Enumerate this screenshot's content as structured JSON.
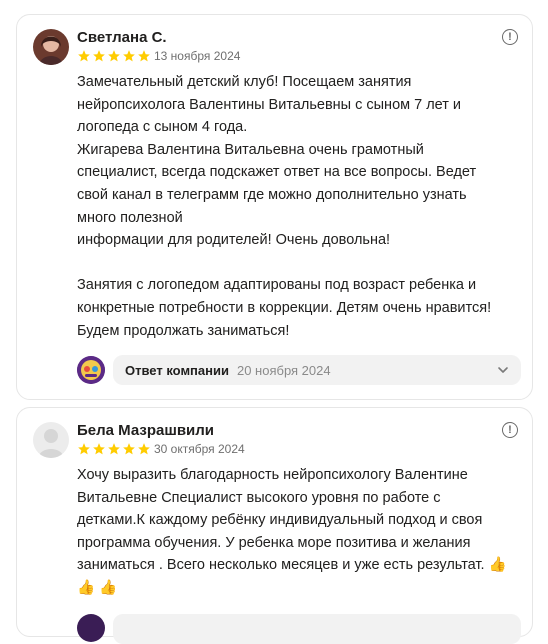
{
  "reviews": [
    {
      "author": "Светлана С.",
      "rating": 5,
      "date": "13 ноября 2024",
      "text": "Замечательный детский клуб! Посещаем занятия\nнейропсихолога Валентины Витальевны с сыном 7 лет и\nлогопеда с сыном 4 года.\nЖигарева Валентина Витальевна очень грамотный\nспециалист, всегда подскажет ответ на все вопросы. Ведет\nсвой канал в телеграмм где можно дополнительно узнать\nмного полезной\nинформации для родителей! Очень довольна!\n\nЗанятия с логопедом адаптированы под возраст ребенка и\nконкретные потребности в коррекции. Детям очень нравится!\nБудем продолжать заниматься!",
      "reply_label": "Ответ компании",
      "reply_date": "20 ноября 2024"
    },
    {
      "author": "Бела Мазрашвили",
      "rating": 5,
      "date": "30 октября 2024",
      "text": "Хочу выразить благодарность нейропсихологу Валентине\nВитальевне Специалист высокого уровня по работе с\nдетками.К каждому ребёнку индивидуальный подход и своя\nпрограмма обучения. У ребенка море позитива и желания\nзаниматься . Всего несколько месяцев и уже есть результат. 👍\n👍 👍"
    }
  ],
  "colors": {
    "star": "#fc0",
    "text": "#21201f",
    "muted": "#6f6f6f"
  },
  "icons": [
    "more-info-icon",
    "star-icon",
    "chevron-down-icon",
    "company-logo"
  ]
}
